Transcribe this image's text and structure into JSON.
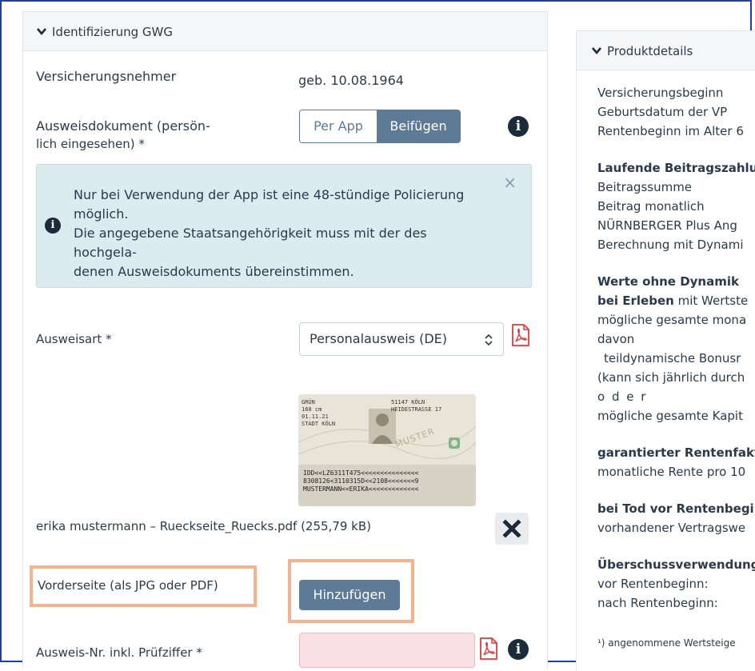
{
  "left": {
    "title": "Identifizierung GWG",
    "insured_label": "Versicherungsnehmer",
    "insured_value": "geb. 10.08.1964",
    "doc_label_1": "Ausweisdokument (persön-",
    "doc_label_2": "lich eingesehen) *",
    "seg_app": "Per App",
    "seg_attach": "Beifügen",
    "alert": {
      "line1": "Nur bei Verwendung der App ist eine 48-stündige Policierung",
      "line2": "möglich.",
      "line3": "Die angegebene Staatsangehörigkeit muss mit der des hochgela-",
      "line4": "denen Ausweisdokuments übereinstimmen.",
      "close": "×"
    },
    "id_type_label": "Ausweisart *",
    "id_type_value": "Personalausweis (DE)",
    "file_name": "erika mustermann – Rueckseite_Ruecks.pdf (255,79 kB)",
    "front_label": "Vorderseite (als JPG oder PDF)",
    "add_button": "Hinzufügen",
    "id_no_label": "Ausweis-Nr. inkl. Prüfziffer *",
    "card": {
      "l1": "GRÜN",
      "l2": "160 cm",
      "l3": "01.11.21",
      "l4": "STADT KÖLN",
      "r1": "51147 KÖLN",
      "r2": "HEIDESTRASSE 17",
      "stamp": "MUSTER",
      "mrz1": "IDD<<LZ6311T475<<<<<<<<<<<<<<<",
      "mrz2": "8308126<3110315D<<2108<<<<<<<9",
      "mrz3": "MUSTERMANN<<ERIKA<<<<<<<<<<<<<"
    }
  },
  "right": {
    "title": "Produktdetails",
    "lines": [
      "Versicherungsbeginn",
      "Geburtsdatum der VP",
      "Rentenbeginn im Alter 6",
      "Laufende Beitragszahlu",
      "Beitragssumme",
      "Beitrag monatlich",
      "NÜRNBERGER Plus Ang",
      "Berechnung mit Dynami",
      "Werte ohne Dynamik",
      "bei Erleben",
      " mit Wertste",
      "mögliche gesamte mona",
      "davon",
      "teildynamische Bonusr",
      "(kann sich jährlich durch",
      "o d e r",
      "mögliche gesamte Kapit",
      "garantierter Rentenfakt",
      "monatliche Rente pro 10",
      "bei Tod vor Rentenbegi",
      "vorhandener Vertragswe",
      "Überschussverwendung",
      "vor Rentenbeginn:",
      "nach Rentenbeginn:"
    ],
    "footnote": "¹) angenommene Wertsteige"
  },
  "colors": {
    "accent": "#5d7a96",
    "alert_bg": "#dcebf0",
    "highlight": "#f2b38e",
    "error_input": "#fadfe4",
    "pdf_red": "#e03a3a"
  }
}
